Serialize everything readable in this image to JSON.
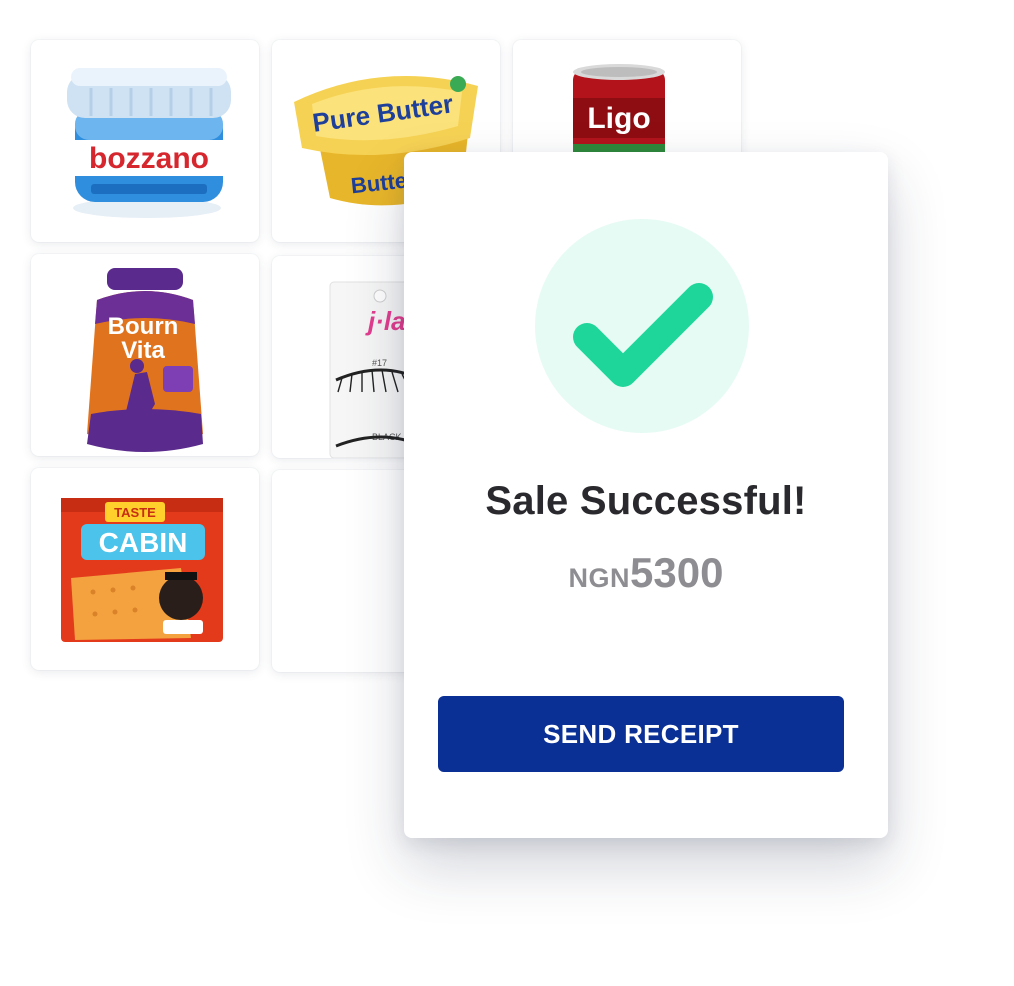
{
  "products": [
    {
      "name": "bozzano",
      "brand_text": "bozzano",
      "color": "#2f8fde"
    },
    {
      "name": "butter",
      "brand_text": "Pure Butter",
      "color": "#f2c73a"
    },
    {
      "name": "ligo",
      "brand_text": "Ligo",
      "color": "#b3141b"
    },
    {
      "name": "bournvita",
      "brand_text_1": "Bourn",
      "brand_text_2": "Vita",
      "color": "#d9641a"
    },
    {
      "name": "eyelashes",
      "brand_text": "j·la",
      "color": "#e33d8f"
    },
    {
      "name": "cabin-biscuit",
      "brand_text": "CABIN",
      "color": "#e43a1c"
    }
  ],
  "modal": {
    "title": "Sale Successful!",
    "currency": "NGN",
    "amount": "5300",
    "button_label": "SEND RECEIPT",
    "accent_color": "#0a2f95",
    "success_color": "#1fd69a",
    "success_bg": "#e6fbf4"
  }
}
